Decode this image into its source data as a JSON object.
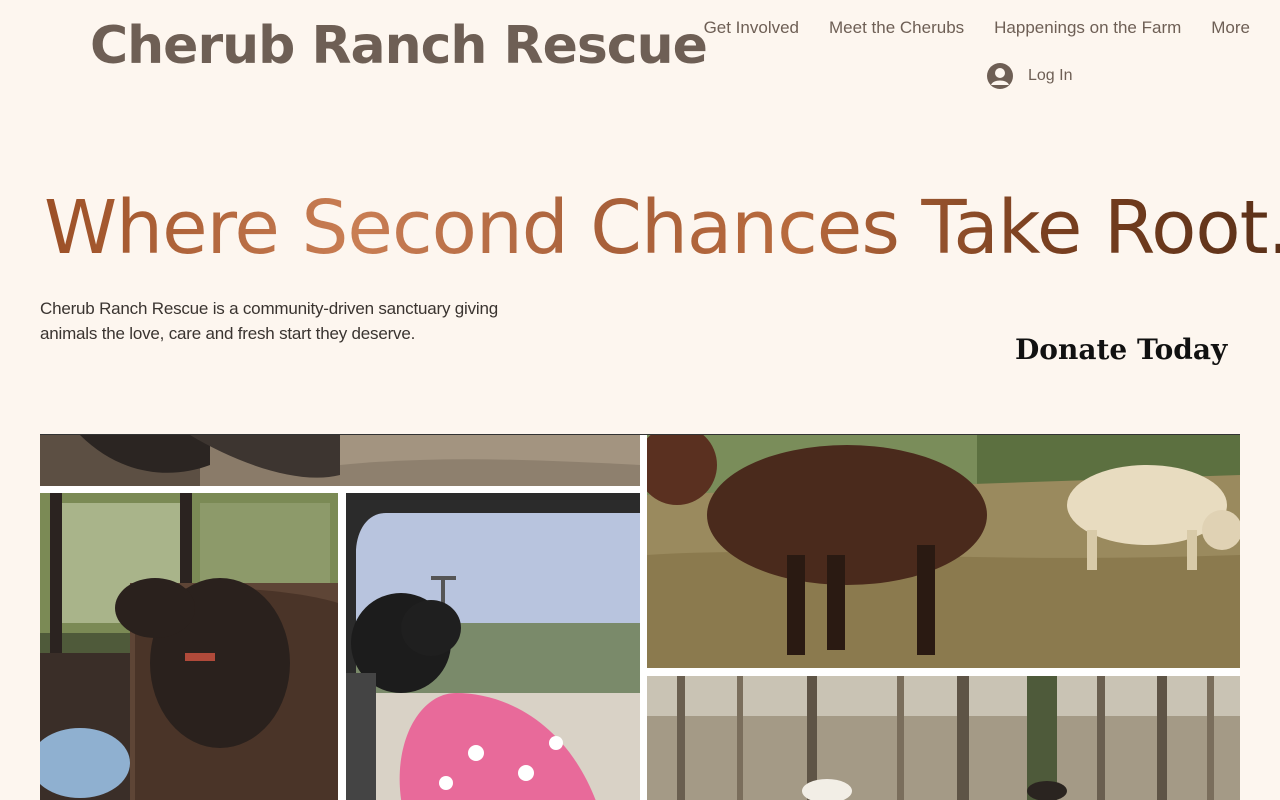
{
  "header": {
    "site_title": "Cherub Ranch Rescue",
    "nav": [
      {
        "label": "Get Involved"
      },
      {
        "label": "Meet the Cherubs"
      },
      {
        "label": "Happenings on the Farm"
      },
      {
        "label": "More"
      }
    ],
    "login_label": "Log In"
  },
  "hero": {
    "headline": "Where Second Chances Take Root.",
    "intro": "Cherub Ranch Rescue is a community-driven sanctuary giving animals the love, care and fresh start they deserve.",
    "donate_label": "Donate Today"
  },
  "icons": {
    "login": "user-avatar-icon"
  },
  "colors": {
    "background": "#fdf6ef",
    "title": "#6e5f55",
    "headline_gradient": "#a4582e",
    "donate": "#111111"
  }
}
